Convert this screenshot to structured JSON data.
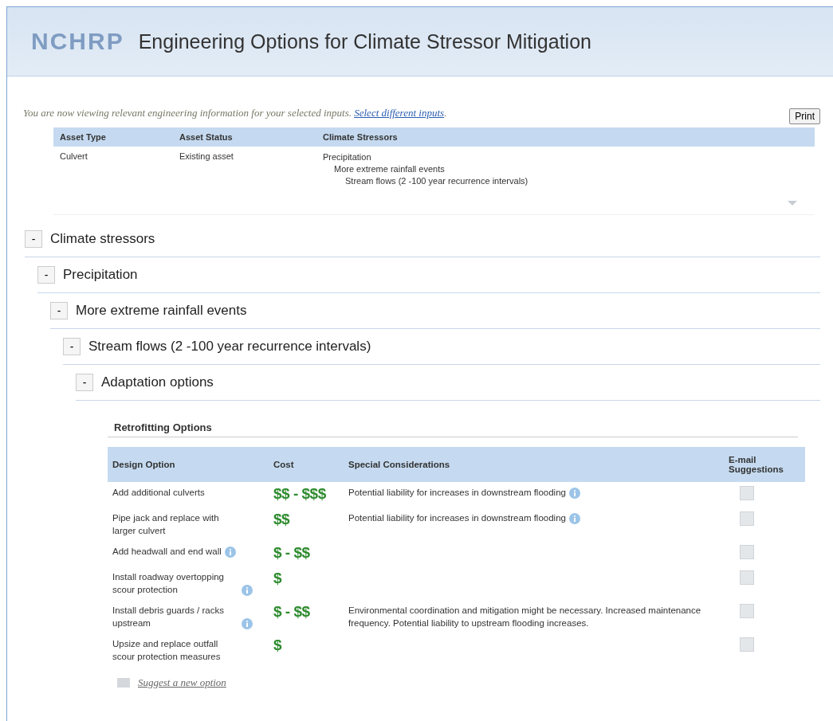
{
  "header": {
    "logo": "NCHRP",
    "title": "Engineering Options for Climate Stressor Mitigation"
  },
  "intro": {
    "text": "You are now viewing relevant engineering information for your selected inputs.",
    "link": "Select different inputs",
    "after": "."
  },
  "print_button": "Print",
  "inputs": {
    "columns": [
      "Asset Type",
      "Asset Status",
      "Climate Stressors"
    ],
    "asset_type": "Culvert",
    "asset_status": "Existing asset",
    "stressors": [
      {
        "label": "Precipitation",
        "children": [
          {
            "label": "More extreme rainfall events",
            "children": [
              {
                "label": "Stream flows (2 -100 year recurrence intervals)"
              }
            ]
          }
        ]
      }
    ]
  },
  "tree": [
    {
      "toggle": "-",
      "label": "Climate stressors",
      "expanded": true,
      "children": [
        {
          "toggle": "-",
          "label": "Precipitation",
          "expanded": true,
          "children": [
            {
              "toggle": "-",
              "label": "More extreme rainfall events",
              "expanded": true,
              "children": [
                {
                  "toggle": "-",
                  "label": "Stream flows (2 -100 year recurrence intervals)",
                  "expanded": true,
                  "children": [
                    {
                      "toggle": "-",
                      "label": "Adaptation options",
                      "expanded": true
                    }
                  ]
                }
              ]
            }
          ]
        }
      ]
    }
  ],
  "options": {
    "title": "Retrofitting Options",
    "columns": [
      "Design Option",
      "Cost",
      "Special Considerations",
      "E-mail Suggestions"
    ],
    "rows": [
      {
        "option": "Add additional culverts",
        "option_info": false,
        "cost": "$$ - $$$",
        "considerations": "Potential liability for increases in downstream flooding",
        "considerations_info": true,
        "checked": false
      },
      {
        "option": "Pipe jack and replace with larger culvert",
        "option_info": false,
        "cost": "$$",
        "considerations": "Potential liability for increases in downstream flooding",
        "considerations_info": true,
        "checked": false
      },
      {
        "option": "Add headwall and end wall",
        "option_info": true,
        "cost": "$ - $$",
        "considerations": "",
        "considerations_info": false,
        "checked": false
      },
      {
        "option": "Install roadway overtopping scour protection",
        "option_info": true,
        "cost": "$",
        "considerations": "",
        "considerations_info": false,
        "checked": false
      },
      {
        "option": "Install debris guards / racks upstream",
        "option_info": true,
        "cost": "$ - $$",
        "considerations": "Environmental coordination and mitigation might be necessary. Increased maintenance frequency. Potential liability to upstream flooding increases.",
        "considerations_info": false,
        "checked": false
      },
      {
        "option": "Upsize and replace outfall scour protection measures",
        "option_info": false,
        "cost": "$",
        "considerations": "",
        "considerations_info": false,
        "checked": false
      }
    ],
    "suggest_link": "Suggest a new option"
  }
}
